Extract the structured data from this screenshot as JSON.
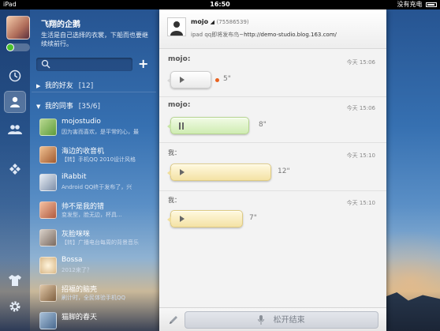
{
  "status_bar": {
    "carrier": "iPad",
    "time": "16:50",
    "battery": "没有充电"
  },
  "profile": {
    "name": "飞翔的企鹅",
    "signature": "生活是自己选择的衣裳，下船而也要继续续前行。"
  },
  "search": {
    "placeholder": ""
  },
  "groups": [
    {
      "name": "我的好友",
      "count": "[12]",
      "expanded": false
    },
    {
      "name": "我的同事",
      "count": "[35/6]",
      "expanded": true
    }
  ],
  "contacts": [
    {
      "name": "mojostudio",
      "message": "因为害而喜欢，是平常的心，最",
      "color": "#6aa04a"
    },
    {
      "name": "海边的收音机",
      "message": "【转】手机QQ 2010设计风格",
      "color": "#c87040"
    },
    {
      "name": "iRabbit",
      "message": "Android QQ终于发布了，兴",
      "color": "#8a9ab0"
    },
    {
      "name": "帅不是我的错",
      "message": "变发型，脸无边，杯具...",
      "color": "#d08060"
    },
    {
      "name": "灰脸咪咪",
      "message": "【转】广播电台每周的背景音乐",
      "color": "#9a8a80"
    },
    {
      "name": "Bossa",
      "message": "2012来了？",
      "color": "#e0c8a0"
    },
    {
      "name": "招福的脑壳",
      "message": "刷计时，全民体验手机QQ",
      "color": "#b09070"
    },
    {
      "name": "猫脚的春天",
      "message": "",
      "color": "#7090b0"
    }
  ],
  "chat": {
    "contact_name": "mojo",
    "contact_qq": "(75586539)",
    "signature_prefix": "ipad qq即将发布鸟~",
    "signature_link": "http://demo-studio.blog.163.com/",
    "messages": [
      {
        "sender": "mojo:",
        "time": "今天 15:06",
        "duration": "5\"",
        "style": "white",
        "state": "play",
        "unread": true
      },
      {
        "sender": "mojo:",
        "time": "今天 15:06",
        "duration": "8\"",
        "style": "green",
        "state": "pause",
        "unread": false
      },
      {
        "sender": "我：",
        "time": "今天 15:10",
        "duration": "12\"",
        "style": "yellow",
        "state": "play",
        "unread": false
      },
      {
        "sender": "我：",
        "time": "今天 15:10",
        "duration": "7\"",
        "style": "yellow",
        "state": "play",
        "unread": false
      }
    ],
    "hold_to_talk": "松开结束"
  },
  "colors": {
    "accent": "#4cc12e",
    "unread_dot": "#e8621f",
    "panel_bg": "#f3f3f3"
  }
}
